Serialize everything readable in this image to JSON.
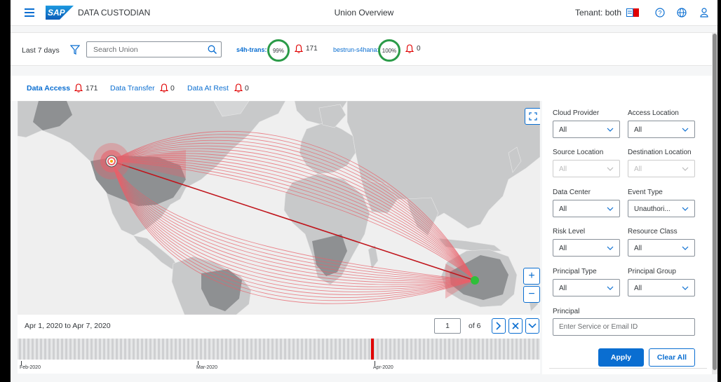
{
  "header": {
    "logo_text": "SAP",
    "app_title": "DATA CUSTODIAN",
    "page_title": "Union Overview",
    "tenant": "Tenant: both",
    "icons": [
      "menu-icon",
      "flag-icon",
      "help-icon",
      "globe-icon",
      "user-icon"
    ]
  },
  "toolbar": {
    "time_range": "Last 7 days",
    "search_placeholder": "Search Union",
    "systems": [
      {
        "name": "s4h-trans:",
        "percent": "99%",
        "alerts": "171"
      },
      {
        "name": "bestrun-s4hana:",
        "percent": "100%",
        "alerts": "0"
      }
    ]
  },
  "tabs": [
    {
      "label": "Data Access",
      "count": "171",
      "active": true
    },
    {
      "label": "Data Transfer",
      "count": "0",
      "active": false
    },
    {
      "label": "Data At Rest",
      "count": "0",
      "active": false
    }
  ],
  "map": {
    "zoom_in": "+",
    "zoom_out": "−",
    "arc_color": "#e8606a",
    "main_arc_color": "#c0151c",
    "source_marker_color": "#e8606a",
    "destination_marker_color": "#2fbf3a"
  },
  "pagination": {
    "date_range": "Apr 1, 2020 to Apr 7, 2020",
    "page": "1",
    "of": "of 6"
  },
  "timeline": {
    "labels": [
      "Feb-2020",
      "Mar-2020",
      "Apr-2020"
    ],
    "highlight_color": "#e00000"
  },
  "filters": {
    "cloud_provider": {
      "label": "Cloud Provider",
      "value": "All"
    },
    "access_location": {
      "label": "Access Location",
      "value": "All"
    },
    "source_location": {
      "label": "Source Location",
      "value": "All"
    },
    "destination_location": {
      "label": "Destination Location",
      "value": "All"
    },
    "data_center": {
      "label": "Data Center",
      "value": "All"
    },
    "event_type": {
      "label": "Event Type",
      "value": "Unauthori..."
    },
    "risk_level": {
      "label": "Risk Level",
      "value": "All"
    },
    "resource_class": {
      "label": "Resource Class",
      "value": "All"
    },
    "principal_type": {
      "label": "Principal Type",
      "value": "All"
    },
    "principal_group": {
      "label": "Principal Group",
      "value": "All"
    },
    "principal": {
      "label": "Principal",
      "placeholder": "Enter Service or Email ID"
    },
    "apply": "Apply",
    "clear": "Clear All"
  },
  "colors": {
    "accent": "#0a6ed1",
    "ring_ok": "#2b9b48",
    "alert": "#e00000"
  }
}
